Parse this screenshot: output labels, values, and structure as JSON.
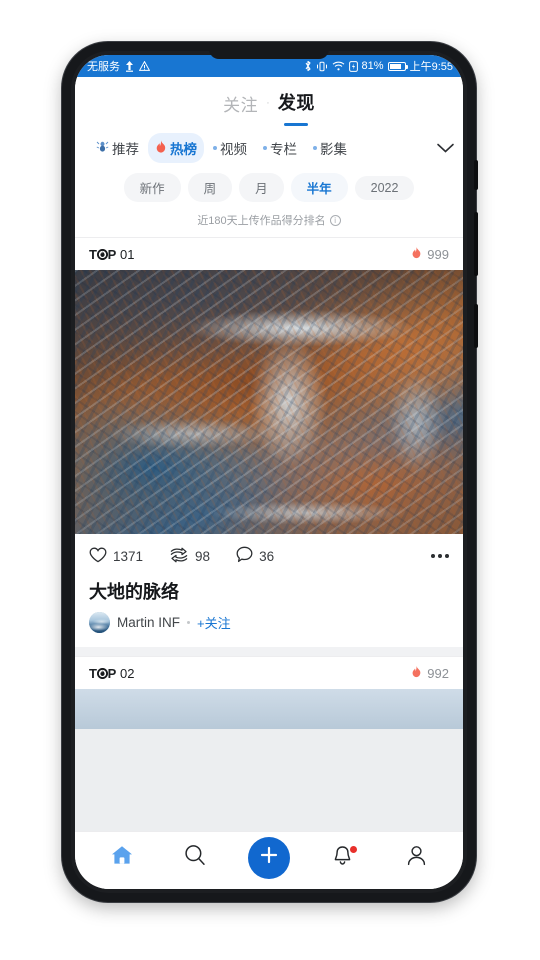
{
  "status_bar": {
    "carrier": "无服务",
    "upload_icon": "upload-arrow-icon",
    "warning_icon": "warning-triangle-icon",
    "bluetooth_icon": "bluetooth-icon",
    "vibrate_icon": "vibrate-icon",
    "wifi_icon": "wifi-icon",
    "battery_saver_icon": "battery-saver-icon",
    "battery_percent": "81%",
    "time": "上午9:55",
    "bg_color": "#1876d2"
  },
  "top_nav": {
    "tabs": [
      {
        "label": "关注",
        "active": false
      },
      {
        "label": "发现",
        "active": true
      }
    ],
    "separator": "·",
    "active_underline_color": "#1876d2"
  },
  "categories": {
    "items": [
      {
        "label": "推荐",
        "icon": "ant-icon",
        "active": false
      },
      {
        "label": "热榜",
        "icon": "flame-icon",
        "active": true
      },
      {
        "label": "视频",
        "icon": "dot-icon",
        "active": false
      },
      {
        "label": "专栏",
        "icon": "dot-icon",
        "active": false
      },
      {
        "label": "影集",
        "icon": "dot-icon",
        "active": false
      }
    ],
    "expand_icon": "chevron-down-icon",
    "active_bg": "#e8f1fd",
    "active_color": "#1876d2"
  },
  "ranges": {
    "items": [
      {
        "label": "新作",
        "active": false
      },
      {
        "label": "周",
        "active": false
      },
      {
        "label": "月",
        "active": false
      },
      {
        "label": "半年",
        "active": true
      },
      {
        "label": "2022",
        "active": false
      }
    ],
    "note": "近180天上传作品得分排名",
    "note_icon": "info-icon"
  },
  "feed": {
    "cards": [
      {
        "rank_word": "TOP",
        "rank_number": "01",
        "hot_icon": "flame-icon",
        "hot_score": "999",
        "likes": "1371",
        "likes_icon": "heart-icon",
        "shares": "98",
        "shares_icon": "share-icon",
        "comments": "36",
        "comments_icon": "comment-icon",
        "more_icon": "more-horizontal-icon",
        "title": "大地的脉络",
        "author": "Martin INF",
        "follow_label": "+关注",
        "avatar_icon": "avatar"
      },
      {
        "rank_word": "TOP",
        "rank_number": "02",
        "hot_icon": "flame-icon",
        "hot_score": "992"
      }
    ]
  },
  "tabbar": {
    "items": [
      {
        "name": "home",
        "icon": "home-icon",
        "active": true
      },
      {
        "name": "search",
        "icon": "search-icon",
        "active": false
      },
      {
        "name": "create",
        "icon": "plus-icon",
        "active": false
      },
      {
        "name": "notifications",
        "icon": "bell-icon",
        "active": false,
        "badge": true
      },
      {
        "name": "profile",
        "icon": "person-icon",
        "active": false
      }
    ],
    "accent_color": "#1168cf",
    "badge_color": "#e8302b"
  }
}
